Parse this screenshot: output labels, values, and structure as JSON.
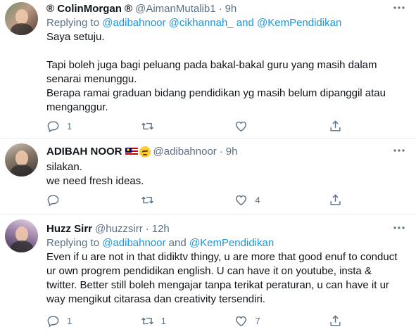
{
  "tweets": [
    {
      "name": "® ColinMorgan ®",
      "handle": "@AimanMutalib1",
      "time": "9h",
      "replying_prefix": "Replying to ",
      "replying_mentions": "@adibahnoor @cikhannah_ and @KemPendidikan",
      "lines": [
        "Saya setuju.",
        "",
        "Tapi boleh juga bagi peluang pada bakal-bakal guru yang masih dalam",
        "senarai menunggu.",
        "Berapa ramai graduan bidang pendidikan yg masih belum dipanggil atau",
        "menganggur."
      ],
      "reply_count": "1",
      "retweet_count": "",
      "like_count": ""
    },
    {
      "name": "ADIBAH NOOR",
      "handle": "@adibahnoor",
      "time": "9h",
      "lines": [
        "silakan.",
        "we need fresh ideas."
      ],
      "reply_count": "",
      "retweet_count": "",
      "like_count": "4"
    },
    {
      "name": "Huzz Sirr",
      "handle": "@huzzsirr",
      "time": "12h",
      "replying_prefix": "Replying to ",
      "replying_mentions_a": "@adibahnoor",
      "replying_and": " and ",
      "replying_mentions_b": "@KemPendidikan",
      "lines": [
        "Even if u are not in that didiktv thingy, u are more that good enuf to conduct",
        "ur own progrem pendidikan english. U can have it on youtube, insta &",
        "twitter. Better still boleh mengajar tanpa terikat peraturan, u can have it ur",
        "way mengikut citarasa dan creativity tersendiri."
      ],
      "reply_count": "1",
      "retweet_count": "1",
      "like_count": "7"
    }
  ],
  "icons": {
    "reply": "reply-icon",
    "retweet": "retweet-icon",
    "like": "like-icon",
    "share": "share-icon",
    "more": "more-icon"
  },
  "colors": {
    "link": "#1b95e0",
    "secondary_text": "#5b7083",
    "divider": "#e6ecf0"
  }
}
